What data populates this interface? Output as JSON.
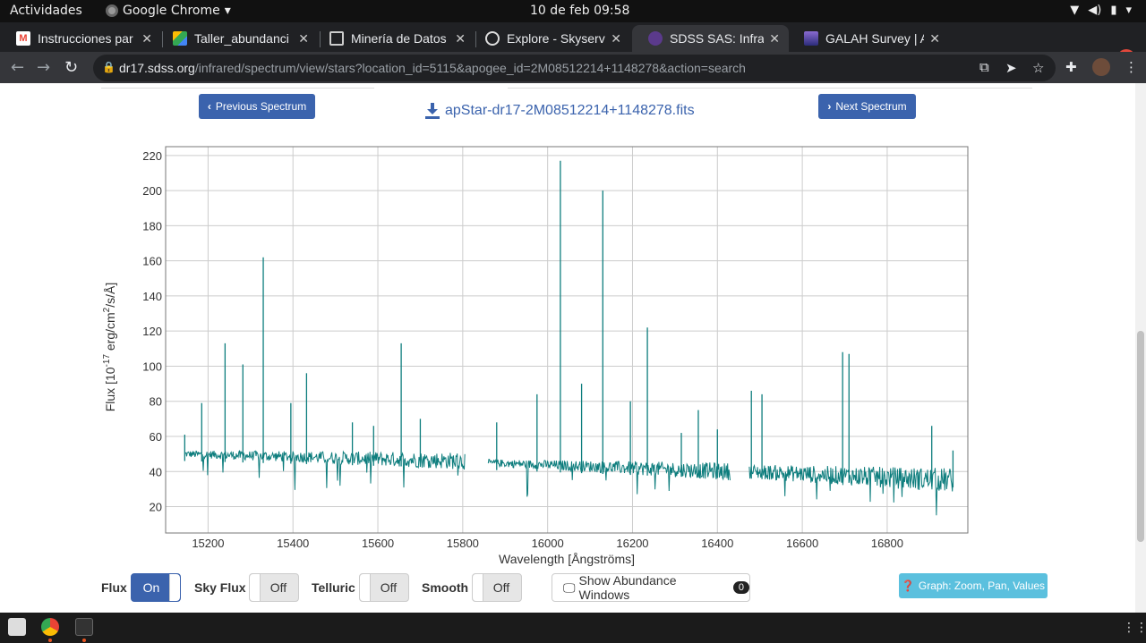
{
  "system_bar": {
    "activities": "Actividades",
    "app_name": "Google Chrome",
    "app_menu_glyph": "▾",
    "clock": "10 de feb  09:58",
    "tray_icons": [
      "wifi-icon",
      "volume-icon",
      "battery-icon",
      "menu-caret-icon"
    ]
  },
  "browser": {
    "tabs": [
      {
        "title": "Instrucciones par",
        "favicon": "gmail-icon",
        "active": false
      },
      {
        "title": "Taller_abundanci",
        "favicon": "drive-icon",
        "active": false
      },
      {
        "title": "Minería de Datos",
        "favicon": "classroom-icon",
        "active": false
      },
      {
        "title": "Explore - Skyserve",
        "favicon": "globe-icon",
        "active": false
      },
      {
        "title": "SDSS SAS: Infrare",
        "favicon": "sdss-icon",
        "active": true
      },
      {
        "title": "GALAH Survey | A",
        "favicon": "galah-icon",
        "active": false
      }
    ],
    "tab_close_glyph": "✕",
    "new_tab_glyph": "+",
    "url_host": "dr17.sdss.org",
    "url_path": "/infrared/spectrum/view/stars?location_id=5115&apogee_id=2M08512214+1148278&action=search"
  },
  "spectrum_nav": {
    "prev_label": "Previous Spectrum",
    "next_label": "Next Spectrum",
    "prev_glyph": "‹",
    "next_glyph": "›",
    "download_link": "apStar-dr17-2M08512214+1148278.fits"
  },
  "chart_data": {
    "type": "line",
    "xlabel": "Wavelength [Ångströms]",
    "ylabel_prefix": "Flux [10",
    "ylabel_exp": "-17",
    "ylabel_mid": " erg/cm",
    "ylabel_exp2": "2",
    "ylabel_suffix": "/s/Å]",
    "xlim": [
      15100,
      16990
    ],
    "ylim": [
      5,
      225
    ],
    "xticks": [
      15200,
      15400,
      15600,
      15800,
      16000,
      16200,
      16400,
      16600,
      16800
    ],
    "yticks": [
      20,
      40,
      60,
      80,
      100,
      120,
      140,
      160,
      180,
      200,
      220
    ],
    "grid": true,
    "series_color": "#0d7d7d",
    "segments": [
      {
        "x_start": 15145,
        "x_end": 15805,
        "base_start": 50,
        "base_end": 46
      },
      {
        "x_start": 15860,
        "x_end": 16430,
        "base_start": 45,
        "base_end": 40
      },
      {
        "x_start": 16475,
        "x_end": 16955,
        "base_start": 40,
        "base_end": 35
      }
    ],
    "lines": [
      {
        "x": 15145,
        "y": 61
      },
      {
        "x": 15185,
        "y": 79
      },
      {
        "x": 15240,
        "y": 113
      },
      {
        "x": 15282,
        "y": 101
      },
      {
        "x": 15330,
        "y": 162
      },
      {
        "x": 15395,
        "y": 79
      },
      {
        "x": 15432,
        "y": 96
      },
      {
        "x": 15540,
        "y": 68
      },
      {
        "x": 15590,
        "y": 66
      },
      {
        "x": 15655,
        "y": 113
      },
      {
        "x": 15700,
        "y": 70
      },
      {
        "x": 15880,
        "y": 68
      },
      {
        "x": 15975,
        "y": 84
      },
      {
        "x": 16030,
        "y": 217
      },
      {
        "x": 16080,
        "y": 90
      },
      {
        "x": 16130,
        "y": 200
      },
      {
        "x": 16195,
        "y": 80
      },
      {
        "x": 16235,
        "y": 122
      },
      {
        "x": 16315,
        "y": 62
      },
      {
        "x": 16355,
        "y": 75
      },
      {
        "x": 16400,
        "y": 64
      },
      {
        "x": 16480,
        "y": 86
      },
      {
        "x": 16505,
        "y": 84
      },
      {
        "x": 16695,
        "y": 108
      },
      {
        "x": 16710,
        "y": 107
      },
      {
        "x": 16905,
        "y": 66
      },
      {
        "x": 16955,
        "y": 52
      }
    ]
  },
  "controls": {
    "flux_label": "Flux",
    "flux_state": "On",
    "sky_label": "Sky Flux",
    "sky_state": "Off",
    "telluric_label": "Telluric",
    "telluric_state": "Off",
    "smooth_label": "Smooth",
    "smooth_state": "Off",
    "abundance_label": "Show Abundance Windows",
    "abundance_count": "0",
    "graph_label": "Graph: Zoom, Pan, Values"
  }
}
